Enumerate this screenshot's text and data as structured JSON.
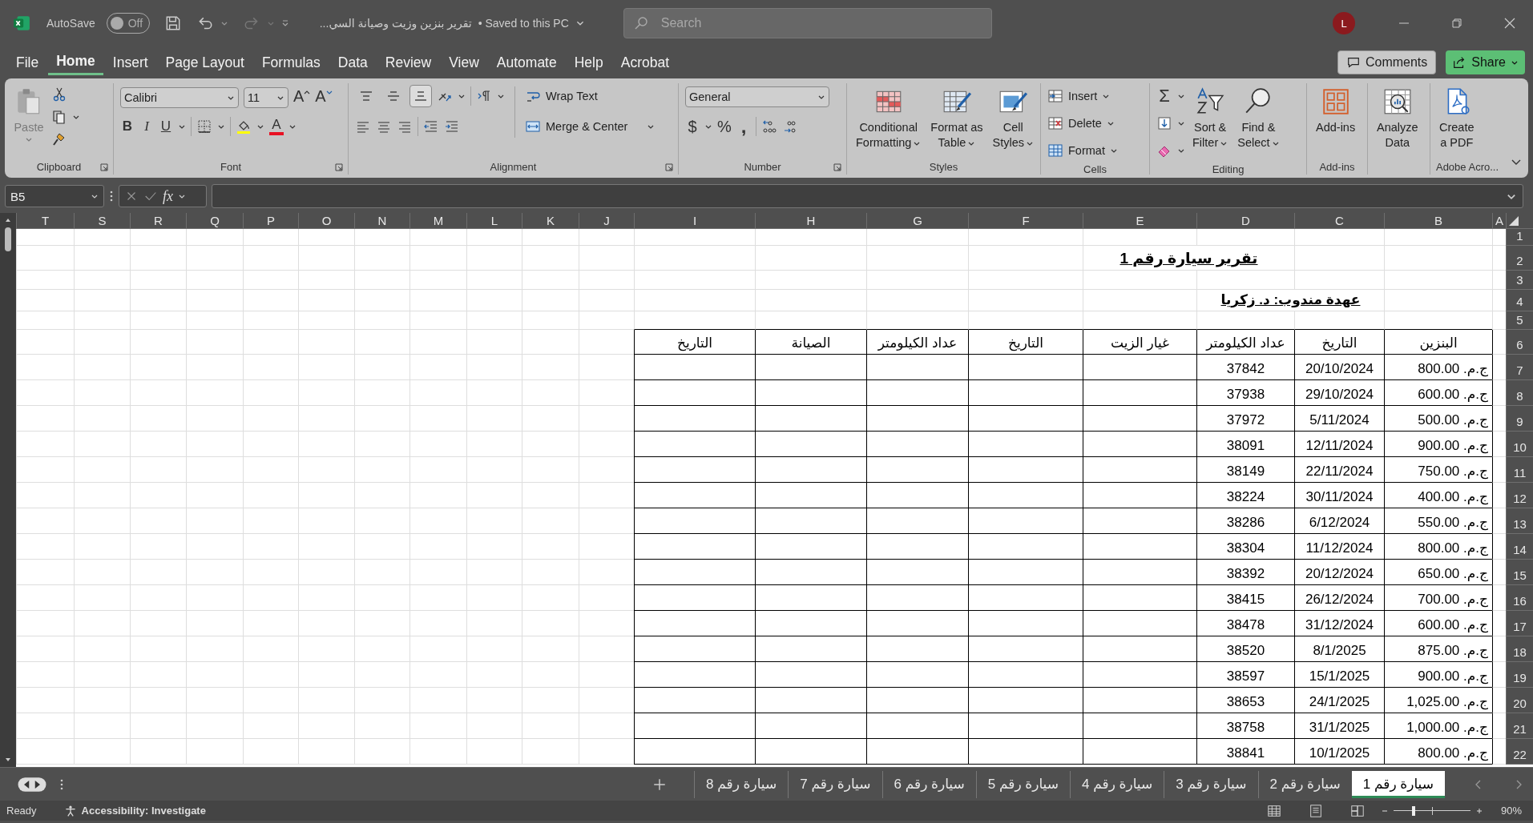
{
  "title_bar": {
    "autosave_label": "AutoSave",
    "autosave": {
      "on": false,
      "text": "Off"
    },
    "document_title": "تقرير بنزين وزيت وصيانة السي...",
    "save_status": "• Saved to this PC",
    "search_placeholder": "Search",
    "avatar": "L"
  },
  "menu_tabs": [
    {
      "label": "File",
      "selected": false
    },
    {
      "label": "Home",
      "selected": true
    },
    {
      "label": "Insert",
      "selected": false
    },
    {
      "label": "Page Layout",
      "selected": false
    },
    {
      "label": "Formulas",
      "selected": false
    },
    {
      "label": "Data",
      "selected": false
    },
    {
      "label": "Review",
      "selected": false
    },
    {
      "label": "View",
      "selected": false
    },
    {
      "label": "Automate",
      "selected": false
    },
    {
      "label": "Help",
      "selected": false
    },
    {
      "label": "Acrobat",
      "selected": false
    }
  ],
  "header_buttons": {
    "comments": "Comments",
    "share": "Share"
  },
  "ribbon": {
    "clipboard": {
      "paste": "Paste",
      "label": "Clipboard"
    },
    "font": {
      "name": "Calibri",
      "size": "11",
      "grow": "A",
      "shrink": "A",
      "bold": "B",
      "italic": "I",
      "underline": "U",
      "font_color": "A",
      "label": "Font"
    },
    "alignment": {
      "vertical": [
        {
          "kind": "top",
          "selected": false
        },
        {
          "kind": "middle",
          "selected": false
        },
        {
          "kind": "bottom",
          "selected": true
        }
      ],
      "wrap_text": "Wrap Text",
      "merge": "Merge & Center",
      "label": "Alignment"
    },
    "number": {
      "format": "General",
      "currency": "$",
      "percent": "%",
      "comma": ",",
      "label": "Number"
    },
    "styles": {
      "buttons": [
        {
          "lines": [
            "Conditional",
            "Formatting"
          ]
        },
        {
          "lines": [
            "Format as",
            "Table"
          ]
        },
        {
          "lines": [
            "Cell",
            "Styles"
          ]
        }
      ],
      "label": "Styles"
    },
    "cells": {
      "buttons": [
        "Insert",
        "Delete",
        "Format"
      ],
      "label": "Cells"
    },
    "editing": {
      "sum": "Σ",
      "sort": [
        "Sort &",
        "Filter"
      ],
      "find": [
        "Find &",
        "Select"
      ],
      "label": "Editing"
    },
    "addins": {
      "lines": [
        "Add-ins"
      ],
      "label": "Add-ins"
    },
    "analyze": {
      "lines": [
        "Analyze",
        "Data"
      ]
    },
    "adobe": {
      "lines": [
        "Create",
        "a PDF"
      ],
      "label": "Adobe Acro..."
    }
  },
  "formula_bar": {
    "name_box": "B5",
    "fx": "fx"
  },
  "columns": [
    "T",
    "S",
    "R",
    "Q",
    "P",
    "O",
    "N",
    "M",
    "L",
    "K",
    "J",
    "I",
    "H",
    "G",
    "F",
    "E",
    "D",
    "C",
    "B",
    "A"
  ],
  "row_numbers": [
    "1",
    "2",
    "3",
    "4",
    "5",
    "6",
    "7",
    "8",
    "9",
    "10",
    "11",
    "12",
    "13",
    "14",
    "15",
    "16",
    "17",
    "18",
    "19",
    "20",
    "21",
    "22"
  ],
  "sheet": {
    "title": "تقرير سيارة رقم 1",
    "subtitle": "عهدة مندوب: د. زكريا",
    "headers": [
      "البنزين",
      "التاريخ",
      "عداد الكيلومتر",
      "غيار الزيت",
      "التاريخ",
      "عداد الكيلومتر",
      "الصيانة",
      "التاريخ"
    ],
    "rows": [
      {
        "fuel": "ج.م. 800.00",
        "date": "20/10/2024",
        "km": "37842"
      },
      {
        "fuel": "ج.م. 600.00",
        "date": "29/10/2024",
        "km": "37938"
      },
      {
        "fuel": "ج.م. 500.00",
        "date": "5/11/2024",
        "km": "37972"
      },
      {
        "fuel": "ج.م. 900.00",
        "date": "12/11/2024",
        "km": "38091"
      },
      {
        "fuel": "ج.م. 750.00",
        "date": "22/11/2024",
        "km": "38149"
      },
      {
        "fuel": "ج.م. 400.00",
        "date": "30/11/2024",
        "km": "38224"
      },
      {
        "fuel": "ج.م. 550.00",
        "date": "6/12/2024",
        "km": "38286"
      },
      {
        "fuel": "ج.م. 800.00",
        "date": "11/12/2024",
        "km": "38304"
      },
      {
        "fuel": "ج.م. 650.00",
        "date": "20/12/2024",
        "km": "38392"
      },
      {
        "fuel": "ج.م. 700.00",
        "date": "26/12/2024",
        "km": "38415"
      },
      {
        "fuel": "ج.م. 600.00",
        "date": "31/12/2024",
        "km": "38478"
      },
      {
        "fuel": "ج.م. 875.00",
        "date": "8/1/2025",
        "km": "38520"
      },
      {
        "fuel": "ج.م. 900.00",
        "date": "15/1/2025",
        "km": "38597"
      },
      {
        "fuel": "ج.م. 1,025.00",
        "date": "24/1/2025",
        "km": "38653"
      },
      {
        "fuel": "ج.م. 1,000.00",
        "date": "31/1/2025",
        "km": "38758"
      },
      {
        "fuel": "ج.م. 800.00",
        "date": "10/1/2025",
        "km": "38841"
      }
    ]
  },
  "sheet_tabs": [
    {
      "label": "سيارة رقم 1",
      "selected": true
    },
    {
      "label": "سيارة رقم 2",
      "selected": false
    },
    {
      "label": "سيارة رقم 3",
      "selected": false
    },
    {
      "label": "سيارة رقم 4",
      "selected": false
    },
    {
      "label": "سيارة رقم 5",
      "selected": false
    },
    {
      "label": "سيارة رقم 6",
      "selected": false
    },
    {
      "label": "سيارة رقم 7",
      "selected": false
    },
    {
      "label": "سيارة رقم 8",
      "selected": false
    }
  ],
  "status_bar": {
    "ready": "Ready",
    "accessibility": "Accessibility: Investigate",
    "zoom": {
      "level": 0.26
    },
    "zoom_text": "90%"
  }
}
